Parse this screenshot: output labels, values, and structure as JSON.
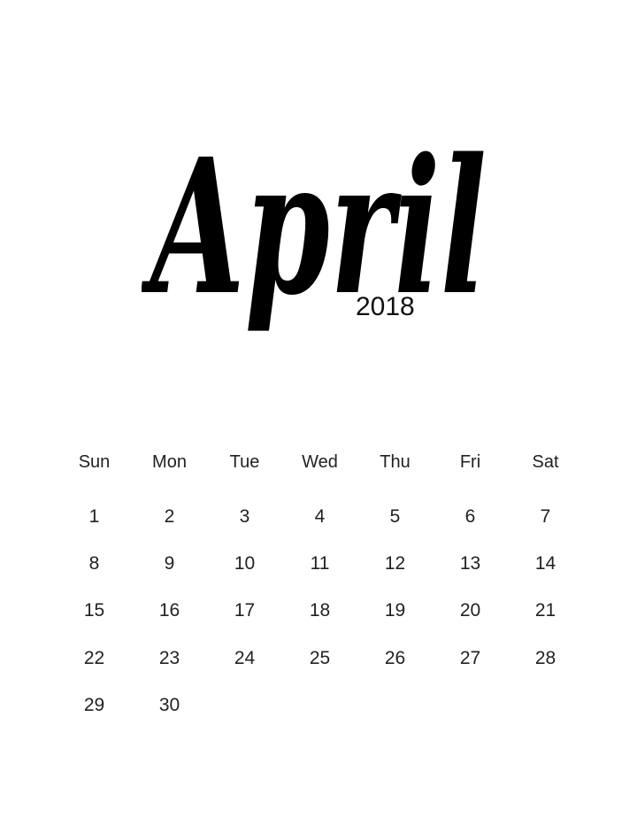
{
  "calendar": {
    "month": "April",
    "year": "2018",
    "weekdays": [
      "Sun",
      "Mon",
      "Tue",
      "Wed",
      "Thu",
      "Fri",
      "Sat"
    ],
    "weeks": [
      [
        "1",
        "2",
        "3",
        "4",
        "5",
        "6",
        "7"
      ],
      [
        "8",
        "9",
        "10",
        "11",
        "12",
        "13",
        "14"
      ],
      [
        "15",
        "16",
        "17",
        "18",
        "19",
        "20",
        "21"
      ],
      [
        "22",
        "23",
        "24",
        "25",
        "26",
        "27",
        "28"
      ],
      [
        "29",
        "30",
        "",
        "",
        "",
        "",
        ""
      ]
    ]
  }
}
